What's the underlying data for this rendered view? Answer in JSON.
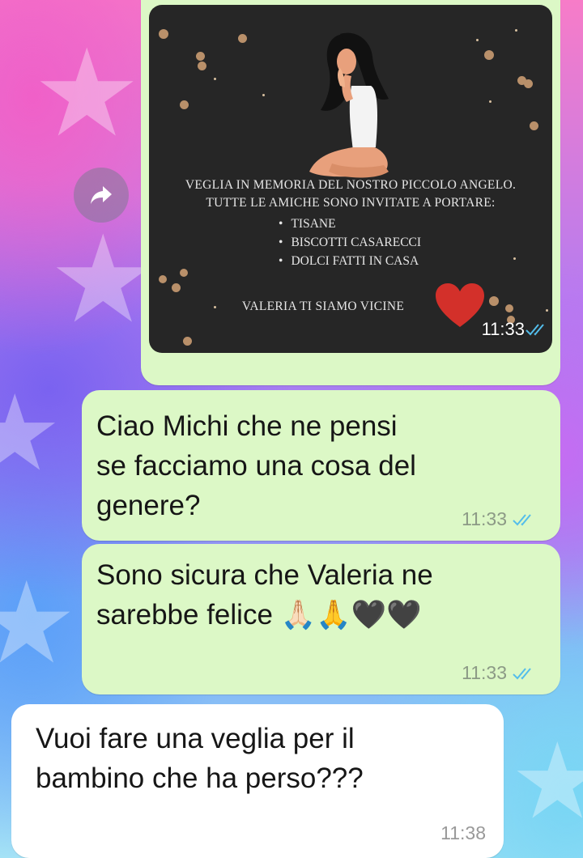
{
  "messages": [
    {
      "type": "image",
      "direction": "outgoing",
      "poster": {
        "heading_line1": "VEGLIA IN MEMORIA DEL NOSTRO PICCOLO ANGELO.",
        "heading_line2": "TUTTE LE AMICHE SONO INVITATE A PORTARE:",
        "items": [
          "TISANE",
          "BISCOTTI CASARECCI",
          "DOLCI FATTI IN CASA"
        ],
        "footer": "VALERIA TI SIAMO VICINE"
      },
      "time": "11:33",
      "status": "read"
    },
    {
      "type": "text",
      "direction": "outgoing",
      "lines": [
        "Ciao Michi che ne pensi",
        "se facciamo una cosa del",
        "genere?"
      ],
      "time": "11:33",
      "status": "read"
    },
    {
      "type": "text",
      "direction": "outgoing",
      "lines": [
        "Sono sicura che Valeria ne",
        "sarebbe felice 🙏🏻🙏🖤🖤"
      ],
      "time": "11:33",
      "status": "read"
    },
    {
      "type": "text",
      "direction": "incoming",
      "lines": [
        "Vuoi fare una veglia per il",
        "bambino che ha perso???"
      ],
      "time": "11:38"
    }
  ],
  "icons": {
    "forward": "forward-arrow-icon",
    "read_receipt": "double-check-icon",
    "heart": "red-heart-icon"
  },
  "colors": {
    "outgoing_bubble": "#dcf8c6",
    "incoming_bubble": "#ffffff",
    "read_tick": "#53bdeb",
    "poster_bg": "#262626"
  }
}
